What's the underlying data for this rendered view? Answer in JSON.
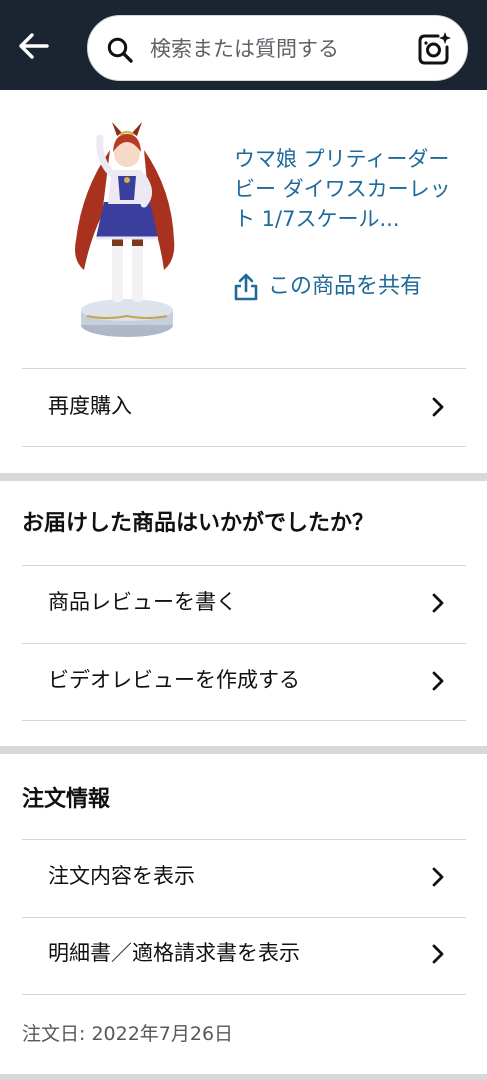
{
  "search": {
    "placeholder": "検索または質問する",
    "icons": [
      "search-icon",
      "camera-sparkle-icon"
    ]
  },
  "nav": {
    "back_icon": "back-arrow-icon"
  },
  "product": {
    "title": "ウマ娘 プリティーダービー ダイワスカーレット 1/7スケール...",
    "share_label": "この商品を共有",
    "image": "figure-product-image"
  },
  "buy_again": {
    "label": "再度購入"
  },
  "feedback": {
    "heading": "お届けした商品はいかがでしたか？",
    "items": [
      {
        "label": "商品レビューを書く"
      },
      {
        "label": "ビデオレビューを作成する"
      }
    ]
  },
  "order_info": {
    "heading": "注文情報",
    "items": [
      {
        "label": "注文内容を表示"
      },
      {
        "label": "明細書／適格請求書を表示"
      }
    ],
    "order_date": "注文日: 2022年7月26日"
  },
  "colors": {
    "topbar": "#1b2431",
    "link": "#1f6a9a",
    "divider": "#d6d6d6",
    "band": "#d5d9d9"
  }
}
